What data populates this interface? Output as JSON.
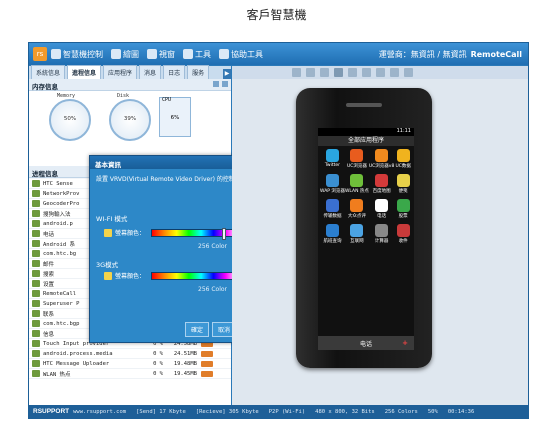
{
  "page_title": "客戶智慧機",
  "toolbar": {
    "logo": "rs",
    "items": [
      "智慧機控制",
      "繪圖",
      "視窗",
      "工具",
      "協助工具"
    ],
    "carrier": "運營商：無資訊 / 無資訊",
    "brand": "RemoteCall"
  },
  "tabs": [
    "系統信息",
    "進程信息",
    "应用程序",
    "消息",
    "日志",
    "服务"
  ],
  "tab_arrow": "▶",
  "memory": {
    "heading": "内存信息",
    "gauges": [
      {
        "label": "Memory",
        "value": "50%"
      },
      {
        "label": "Disk",
        "value": "39%"
      }
    ],
    "cpu": {
      "label": "CPU",
      "value": "6%"
    }
  },
  "process": {
    "heading": "进程信息",
    "rows": [
      {
        "name": "HTC Sense",
        "pct": "",
        "mem": ""
      },
      {
        "name": "NetworkProv",
        "pct": "",
        "mem": ""
      },
      {
        "name": "GeocoderPro",
        "pct": "",
        "mem": ""
      },
      {
        "name": "搜狗輸入法",
        "pct": "",
        "mem": ""
      },
      {
        "name": "android.p",
        "pct": "",
        "mem": ""
      },
      {
        "name": "电话",
        "pct": "",
        "mem": ""
      },
      {
        "name": "Android 系",
        "pct": "",
        "mem": ""
      },
      {
        "name": "com.htc.bg",
        "pct": "",
        "mem": ""
      },
      {
        "name": "邮件",
        "pct": "",
        "mem": ""
      },
      {
        "name": "搜索",
        "pct": "",
        "mem": ""
      },
      {
        "name": "设置",
        "pct": "",
        "mem": ""
      },
      {
        "name": "RemoteCall",
        "pct": "",
        "mem": ""
      },
      {
        "name": "Superuser P",
        "pct": "",
        "mem": ""
      },
      {
        "name": "联系",
        "pct": "",
        "mem": ""
      },
      {
        "name": "com.htc.bgp",
        "pct": "",
        "mem": ""
      },
      {
        "name": "信息",
        "pct": "0 %",
        "mem": "35.80MB"
      },
      {
        "name": "Touch Input provider",
        "pct": "0 %",
        "mem": "24.58MB"
      },
      {
        "name": "android.process.media",
        "pct": "0 %",
        "mem": "24.51MB"
      },
      {
        "name": "HTC Message Uploader",
        "pct": "0 %",
        "mem": "19.48MB"
      },
      {
        "name": "WLAN 热点",
        "pct": "0 %",
        "mem": "19.45MB"
      }
    ]
  },
  "dialog": {
    "title": "基本資訊",
    "desc": "設置 VRVD(Virtual Remote Video Driver) 的控制選項",
    "wifi_label": "WI-FI 模式",
    "wifi_color_label": "螢幕顏色：",
    "wifi_value": "256 Color",
    "mobile_label": "3G模式",
    "mobile_color_label": "螢幕顏色：",
    "mobile_value": "256 Color",
    "buttons": [
      "確定",
      "取消",
      "套用"
    ]
  },
  "phone": {
    "status_time": "11:11",
    "screen_title": "全部应用程序",
    "apps": [
      {
        "label": "Twitter",
        "color": "#2aa6e0"
      },
      {
        "label": "UC浏览器",
        "color": "#e85c1e"
      },
      {
        "label": "UC浏览器v8",
        "color": "#f08a1e"
      },
      {
        "label": "UC数据",
        "color": "#f0b31e"
      },
      {
        "label": "WAP 浏览器",
        "color": "#3a8fd1"
      },
      {
        "label": "WLAN 热点",
        "color": "#6fbf3a"
      },
      {
        "label": "百度地图",
        "color": "#d33a3a"
      },
      {
        "label": "便笺",
        "color": "#e7d04a"
      },
      {
        "label": "传输数据",
        "color": "#3a6fd1"
      },
      {
        "label": "大众点评",
        "color": "#f07d1e"
      },
      {
        "label": "电话",
        "color": "#ffffff"
      },
      {
        "label": "股票",
        "color": "#3aa84a"
      },
      {
        "label": "航班查询",
        "color": "#2b7fd0"
      },
      {
        "label": "互联网",
        "color": "#4ba3e3"
      },
      {
        "label": "计算器",
        "color": "#888888"
      },
      {
        "label": "收件",
        "color": "#c93a3a"
      }
    ],
    "dock_label": "电话"
  },
  "statusbar": {
    "logo": "RSUPPORT",
    "url": "www.rsupport.com",
    "send": "[Send] 17 Kbyte",
    "recv": "[Recieve] 305 Kbyte",
    "mode": "P2P (Wi-Fi)",
    "res": "480 x 800, 32 Bits",
    "colors": "256 Colors",
    "zoom": "50%",
    "time": "00:14:36"
  }
}
